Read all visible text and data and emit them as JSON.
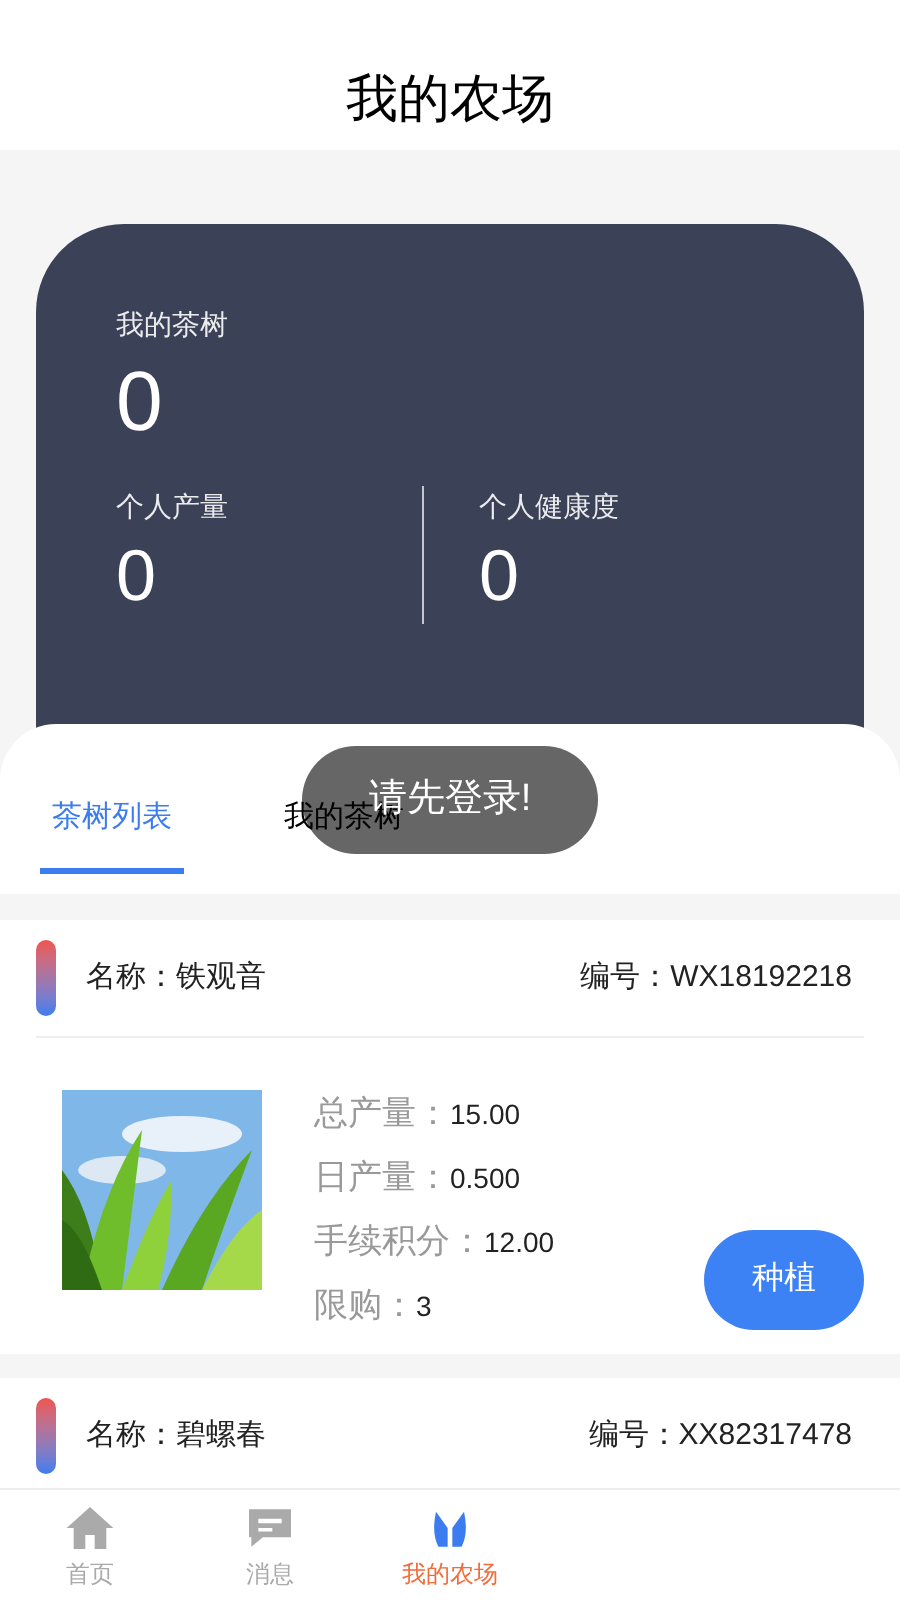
{
  "title": "我的农场",
  "summary": {
    "trees_label": "我的茶树",
    "trees_value": "0",
    "stats": [
      {
        "label": "个人产量",
        "value": "0"
      },
      {
        "label": "个人健康度",
        "value": "0"
      }
    ]
  },
  "tabs": [
    {
      "label": "茶树列表",
      "selected": true
    },
    {
      "label": "我的茶树",
      "selected": false
    }
  ],
  "toast": "请先登录!",
  "trees": [
    {
      "name": "名称：铁观音",
      "code": "编号：WX18192218",
      "details": [
        {
          "label": "总产量：",
          "value": "15.00"
        },
        {
          "label": "日产量：",
          "value": "0.500"
        },
        {
          "label": "手续积分：",
          "value": "12.00"
        },
        {
          "label": "限购：",
          "value": "3"
        }
      ],
      "button": "种植"
    },
    {
      "name": "名称：碧螺春",
      "code": "编号：XX82317478"
    }
  ],
  "nav": [
    {
      "label": "首页",
      "kind": "home",
      "selected": false
    },
    {
      "label": "消息",
      "kind": "message",
      "selected": false
    },
    {
      "label": "我的农场",
      "kind": "farm",
      "selected": true
    }
  ]
}
